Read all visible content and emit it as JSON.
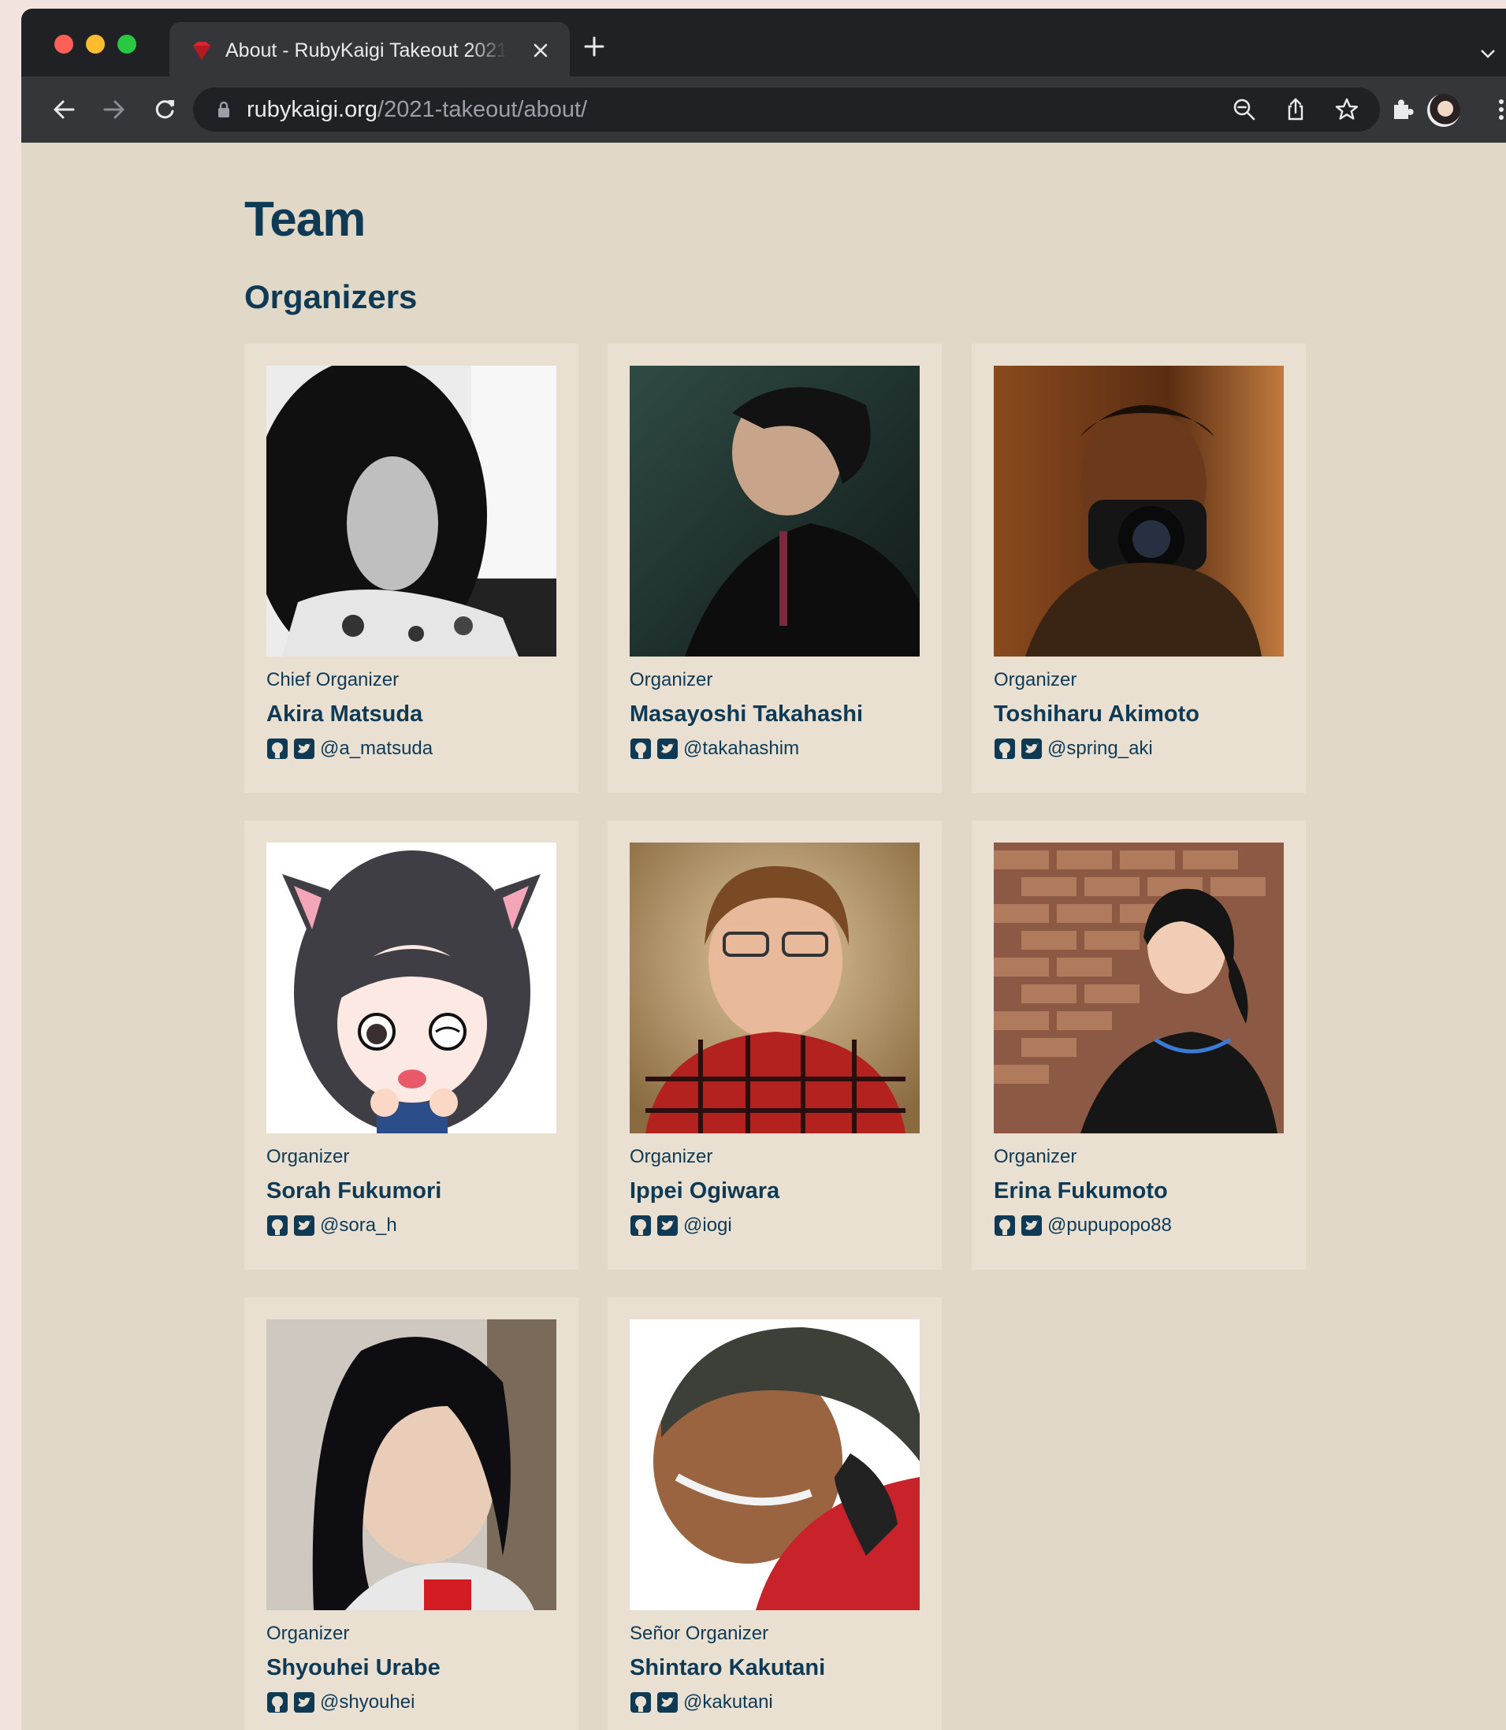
{
  "browser": {
    "tab_title": "About - RubyKaigi Takeout 2021",
    "url_host": "rubykaigi.org",
    "url_path": "/2021-takeout/about/"
  },
  "page": {
    "title": "Team",
    "section": "Organizers"
  },
  "members": [
    {
      "role": "Chief Organizer",
      "name": "Akira Matsuda",
      "handle": "@a_matsuda"
    },
    {
      "role": "Organizer",
      "name": "Masayoshi Takahashi",
      "handle": "@takahashim"
    },
    {
      "role": "Organizer",
      "name": "Toshiharu Akimoto",
      "handle": "@spring_aki"
    },
    {
      "role": "Organizer",
      "name": "Sorah Fukumori",
      "handle": "@sora_h"
    },
    {
      "role": "Organizer",
      "name": "Ippei Ogiwara",
      "handle": "@iogi"
    },
    {
      "role": "Organizer",
      "name": "Erina Fukumoto",
      "handle": "@pupupopo88"
    },
    {
      "role": "Organizer",
      "name": "Shyouhei Urabe",
      "handle": "@shyouhei"
    },
    {
      "role": "Señor Organizer",
      "name": "Shintaro Kakutani",
      "handle": "@kakutani"
    }
  ],
  "colors": {
    "heading": "#0f3a56",
    "page_bg": "#e2d8c8",
    "card_bg": "#e9e0d2"
  }
}
